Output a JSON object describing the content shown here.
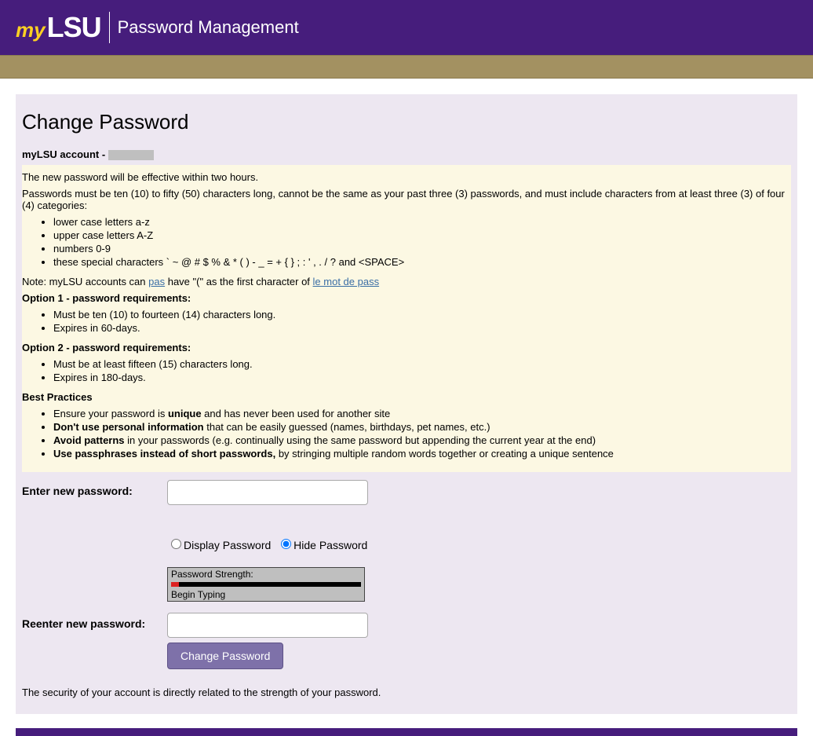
{
  "header": {
    "logo_my": "my",
    "logo_lsu": "LSU",
    "title": "Password Management"
  },
  "page": {
    "title": "Change Password",
    "account_label": "myLSU account - "
  },
  "info": {
    "effective": "The new password will be effective within two hours.",
    "rules_intro": "Passwords must be ten (10) to fifty (50) characters long, cannot be the same as your past three (3) passwords, and must include characters from at least three (3) of four (4) categories:",
    "categories": [
      "lower case letters a-z",
      "upper case letters A-Z",
      "numbers 0-9",
      "these special characters ` ~ @ # $ % & * ( ) - _ = + { } ; : ' , . / ? and <SPACE>"
    ],
    "note_prefix": "Note: myLSU accounts can ",
    "note_link1": "pas",
    "note_mid": " have \"(\" as the first character of ",
    "note_link2": "le mot de pass",
    "opt1_title": "Option 1 - password requirements:",
    "opt1_items": [
      "Must be ten (10) to fourteen (14) characters long.",
      "Expires in 60-days."
    ],
    "opt2_title": "Option 2 - password requirements:",
    "opt2_items": [
      "Must be at least fifteen (15) characters long.",
      "Expires in 180-days."
    ],
    "bp_title": "Best Practices",
    "bp1_a": "Ensure your password is ",
    "bp1_b": "unique",
    "bp1_c": " and has never been used for another site",
    "bp2_a": "Don't use personal information",
    "bp2_b": " that can be easily guessed (names, birthdays, pet names, etc.)",
    "bp3_a": "Avoid patterns",
    "bp3_b": " in your passwords (e.g. continually using the same password but appending the current year at the end)",
    "bp4_a": "Use passphrases instead of short passwords,",
    "bp4_b": " by stringing multiple random words together or creating a unique sentence"
  },
  "form": {
    "enter_label": "Enter new password:",
    "display_label": "Display Password",
    "hide_label": "Hide Password",
    "strength_label": "Password Strength:",
    "strength_status": "Begin Typing",
    "reenter_label": "Reenter new password:",
    "button": "Change Password",
    "security_note": "The security of your account is directly related to the strength of your password."
  }
}
